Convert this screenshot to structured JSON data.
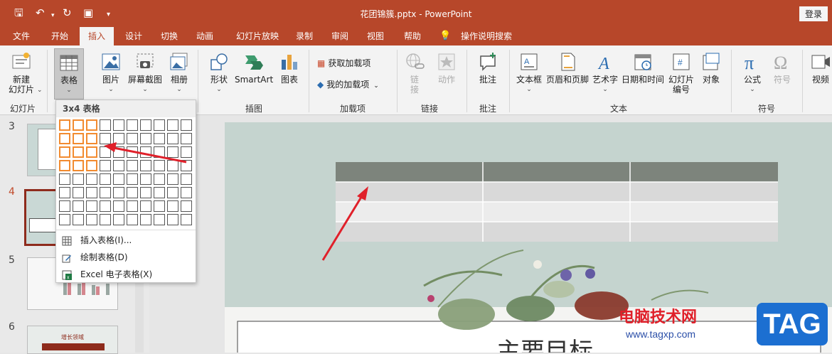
{
  "window": {
    "title": "花团锦簇.pptx  -  PowerPoint",
    "login": "登录"
  },
  "tabs": [
    "文件",
    "开始",
    "插入",
    "设计",
    "切换",
    "动画",
    "幻灯片放映",
    "录制",
    "审阅",
    "视图",
    "帮助",
    "操作说明搜索"
  ],
  "active_tab": "插入",
  "ribbon": {
    "new_slide": "新建\n幻灯片",
    "table": "表格",
    "image": "图片",
    "screenshot": "屏幕截图",
    "album": "相册",
    "shapes": "形状",
    "smartart": "SmartArt",
    "chart": "图表",
    "get_addins": "获取加载项",
    "my_addins": "我的加载项",
    "link": "链接",
    "link_v": "链\n接",
    "action": "动作",
    "comment": "批注",
    "textbox": "文本框",
    "header_footer": "页眉和页脚",
    "wordart": "艺术字",
    "datetime": "日期和时间",
    "slide_number": "幻灯片\n编号",
    "object": "对象",
    "equation": "公式",
    "symbol": "符号",
    "video": "视频",
    "groups": {
      "slides": "幻灯片",
      "illustrations": "插图",
      "addins": "加载项",
      "links": "链接",
      "comments": "批注",
      "text": "文本",
      "symbols": "符号"
    }
  },
  "table_menu": {
    "title": "3x4 表格",
    "selected_cols": 3,
    "selected_rows": 4,
    "insert_table": "插入表格(I)...",
    "draw_table": "绘制表格(D)",
    "excel_table": "Excel 电子表格(X)"
  },
  "slides": {
    "numbers": [
      "3",
      "4",
      "5",
      "6"
    ],
    "thumb6_title": "增长领域"
  },
  "slide_title_partial": "主要目标",
  "watermark": {
    "text": "电脑技术网",
    "url": "www.tagxp.com",
    "badge": "TAG"
  },
  "colors": {
    "accent": "#b7472a",
    "selection": "#f28b30",
    "arrow": "#e0202a"
  }
}
